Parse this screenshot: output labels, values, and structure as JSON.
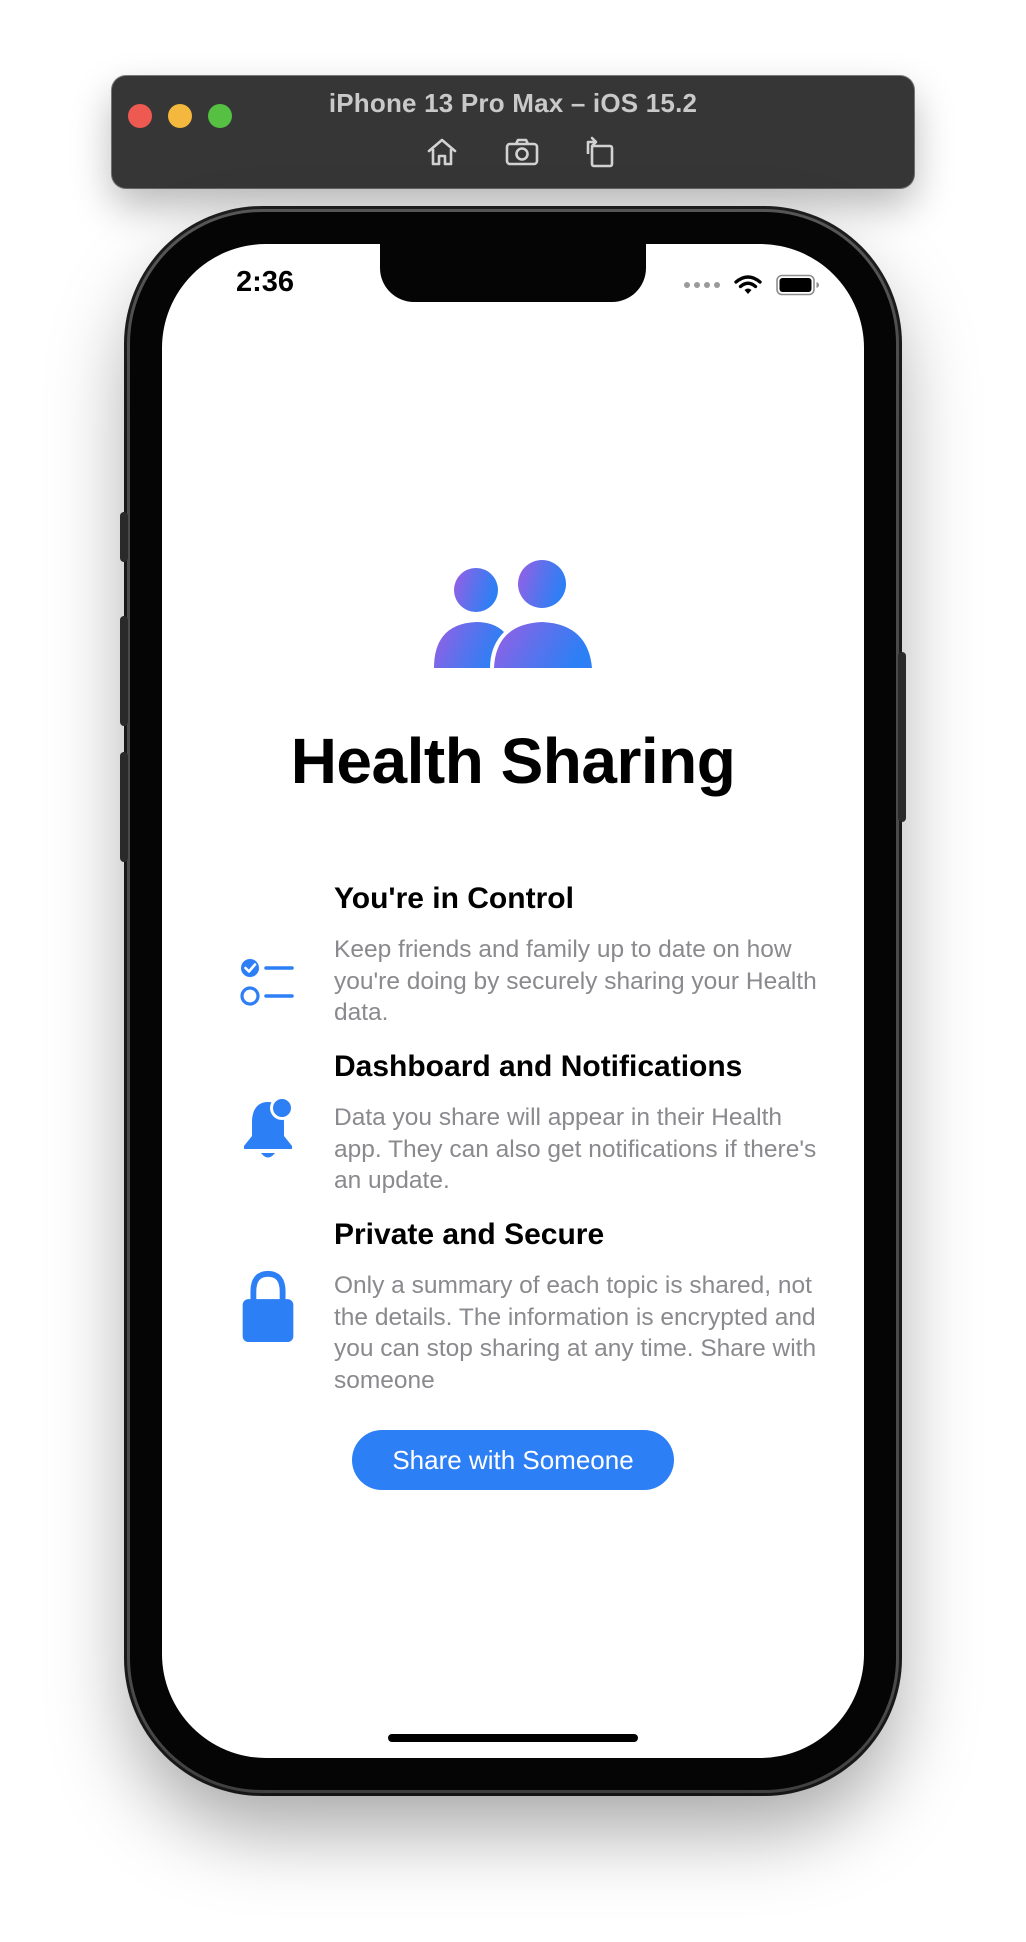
{
  "simulator": {
    "title": "iPhone 13 Pro Max – iOS 15.2",
    "tools": [
      "home-icon",
      "screenshot-icon",
      "rotate-icon"
    ]
  },
  "status_bar": {
    "time": "2:36",
    "icons": [
      "signal-icon",
      "wifi-icon",
      "battery-icon"
    ]
  },
  "hero": {
    "icon": "people-icon",
    "title": "Health Sharing"
  },
  "features": [
    {
      "icon": "checklist-icon",
      "title": "You're in Control",
      "description": "Keep friends and family up to date on how you're doing by securely sharing your Health data."
    },
    {
      "icon": "bell-badge-icon",
      "title": "Dashboard and Notifications",
      "description": "Data you share will appear in their Health app. They can also get notifications if there's an update."
    },
    {
      "icon": "lock-icon",
      "title": "Private and Secure",
      "description": "Only a summary of each topic is shared, not the details. The information is encrypted and you can stop sharing at any time. Share with someone"
    }
  ],
  "primary_action": {
    "label": "Share with Someone"
  },
  "colors": {
    "accent": "#2d7ff5",
    "secondary_text": "#8a8a8e",
    "gradient_start": "#9b5de5",
    "gradient_end": "#2d7ff5"
  }
}
